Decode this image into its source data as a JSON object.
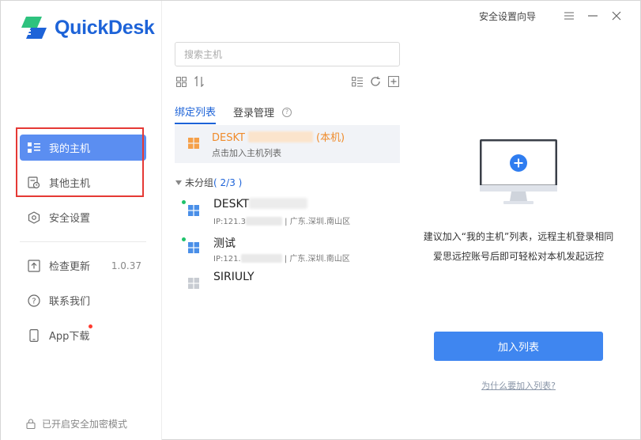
{
  "app": {
    "brand": "QuickDesk",
    "accent": "#1d63d8",
    "version": "1.0.37"
  },
  "window": {
    "setup_guide": "安全设置向导",
    "menu_icon": "menu-icon",
    "minimize_icon": "minimize-icon",
    "close_icon": "close-icon"
  },
  "sidebar": {
    "items": [
      {
        "label": "我的主机",
        "icon": "my-hosts-icon",
        "active": true
      },
      {
        "label": "其他主机",
        "icon": "other-hosts-icon"
      },
      {
        "label": "安全设置",
        "icon": "shield-icon"
      }
    ],
    "bottom_items": [
      {
        "label": "检查更新",
        "icon": "update-icon",
        "extra": "1.0.37"
      },
      {
        "label": "联系我们",
        "icon": "help-icon"
      },
      {
        "label": "App下载",
        "icon": "phone-icon",
        "badge": true
      }
    ],
    "footer": "已开启安全加密模式"
  },
  "search": {
    "placeholder": "搜索主机"
  },
  "tabs": [
    {
      "label": "绑定列表",
      "active": true
    },
    {
      "label": "登录管理"
    }
  ],
  "local_host": {
    "name": "DESKT",
    "suffix": "(本机)",
    "subtitle": "点击加入主机列表"
  },
  "group": {
    "label": "未分组",
    "count": "( 2/3 )"
  },
  "hosts": [
    {
      "name": "DESKT",
      "ip": "IP:121.3",
      "location": "| 广东.深圳.南山区",
      "online": true
    },
    {
      "name": "测试",
      "ip": "IP:121.",
      "location": "| 广东.深圳.南山区",
      "online": true
    },
    {
      "name": "SIRIULY",
      "online": false
    }
  ],
  "empty": {
    "line1": "建议加入“我的主机”列表，远程主机登录相同",
    "line2": "爱思远控账号后即可轻松对本机发起远控",
    "button": "加入列表",
    "link": "为什么要加入列表?"
  }
}
